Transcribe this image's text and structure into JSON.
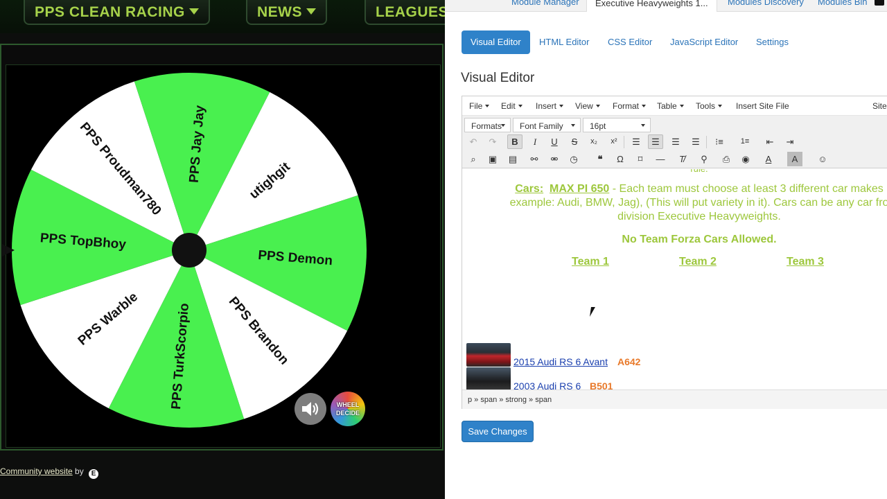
{
  "site": {
    "nav": [
      "PPS CLEAN RACING",
      "NEWS",
      "LEAGUES"
    ],
    "wheel_segments": [
      "utighgit",
      "PPS Demon",
      "PPS Brandon",
      "PPS TurkScorpio",
      "PPS Warble",
      "PPS TopBhoy",
      "PPS Proudman780",
      "PPS Jay Jay"
    ],
    "wheel_colors": [
      "#ffffff",
      "#49f04f",
      "#ffffff",
      "#49f04f",
      "#ffffff",
      "#49f04f",
      "#ffffff",
      "#49f04f"
    ],
    "logo_line1": "WHEEL",
    "logo_line2": "DECIDE",
    "footer_link": "Community website",
    "footer_by": "by",
    "footer_logo": "E"
  },
  "admin": {
    "tabs": [
      "Module Manager",
      "Executive Heavyweights 1...",
      "Modules Discovery",
      "Modules Bin"
    ],
    "subtabs": [
      "Visual Editor",
      "HTML Editor",
      "CSS Editor",
      "JavaScript Editor",
      "Settings"
    ],
    "heading": "Visual Editor",
    "menubar": [
      "File",
      "Edit",
      "Insert",
      "View",
      "Format",
      "Table",
      "Tools",
      "Insert Site File",
      "Site"
    ],
    "formats_label": "Formats",
    "font_family_label": "Font Family",
    "font_size_label": "16pt",
    "content": {
      "cars_label": "Cars:",
      "cars_class": "MAX PI 650",
      "line1_rest": " - Each team must choose at least 3 different car makes",
      "line2": "example: Audi, BMW, Jag), (This will put variety in it).  Cars can be any car fro",
      "line3": "division Executive Heavyweights.",
      "no_forza": "No Team Forza Cars Allowed.",
      "teams": [
        "Team 1",
        "Team 2",
        "Team 3"
      ],
      "cars": [
        {
          "name": "2015 Audi RS 6 Avant",
          "class": "A642"
        },
        {
          "name": "2003 Audi RS 6",
          "class": "B501"
        }
      ]
    },
    "statusbar": "p » span » strong » span",
    "save_label": "Save Changes"
  }
}
